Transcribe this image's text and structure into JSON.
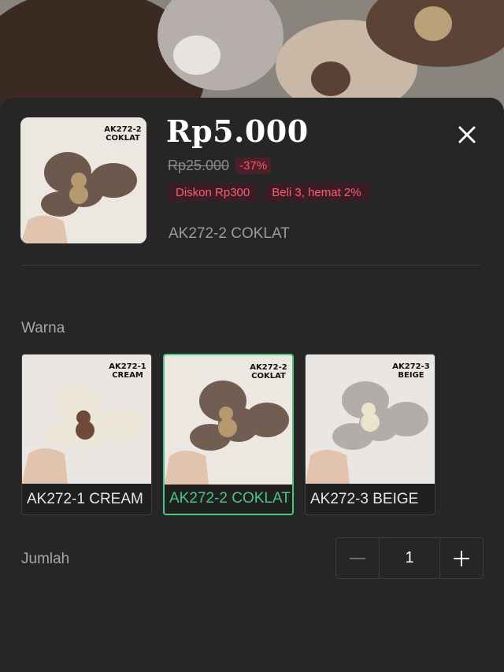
{
  "product": {
    "price": "Rp5.000",
    "original_price": "Rp25.000",
    "discount_percent": "-37%",
    "promos": [
      "Diskon Rp300",
      "Beli 3, hemat 2%"
    ],
    "selected_variant": "AK272-2 COKLAT",
    "thumb_label": [
      "AK272-2",
      "COKLAT"
    ]
  },
  "color_section": {
    "label": "Warna",
    "options": [
      {
        "label": "AK272-1 CREAM",
        "photo_label": [
          "AK272-1",
          "CREAM"
        ],
        "fur_color": "#ece6d8",
        "bear_color": "#6e4a3a",
        "selected": false
      },
      {
        "label": "AK272-2 COKLAT",
        "photo_label": [
          "AK272-2",
          "COKLAT"
        ],
        "fur_color": "#715d52",
        "bear_color": "#b49a6e",
        "selected": true
      },
      {
        "label": "AK272-3 BEIGE",
        "photo_label": [
          "AK272-3",
          "BEIGE"
        ],
        "fur_color": "#b2adab",
        "bear_color": "#ece3cc",
        "selected": false
      }
    ]
  },
  "quantity": {
    "label": "Jumlah",
    "value": "1"
  },
  "colors": {
    "accent_selected": "#4cc584",
    "discount_red": "#ff5a70",
    "sheet_bg": "#262626"
  },
  "icons": {
    "close": "close-icon",
    "minus": "minus-icon",
    "plus": "plus-icon"
  }
}
